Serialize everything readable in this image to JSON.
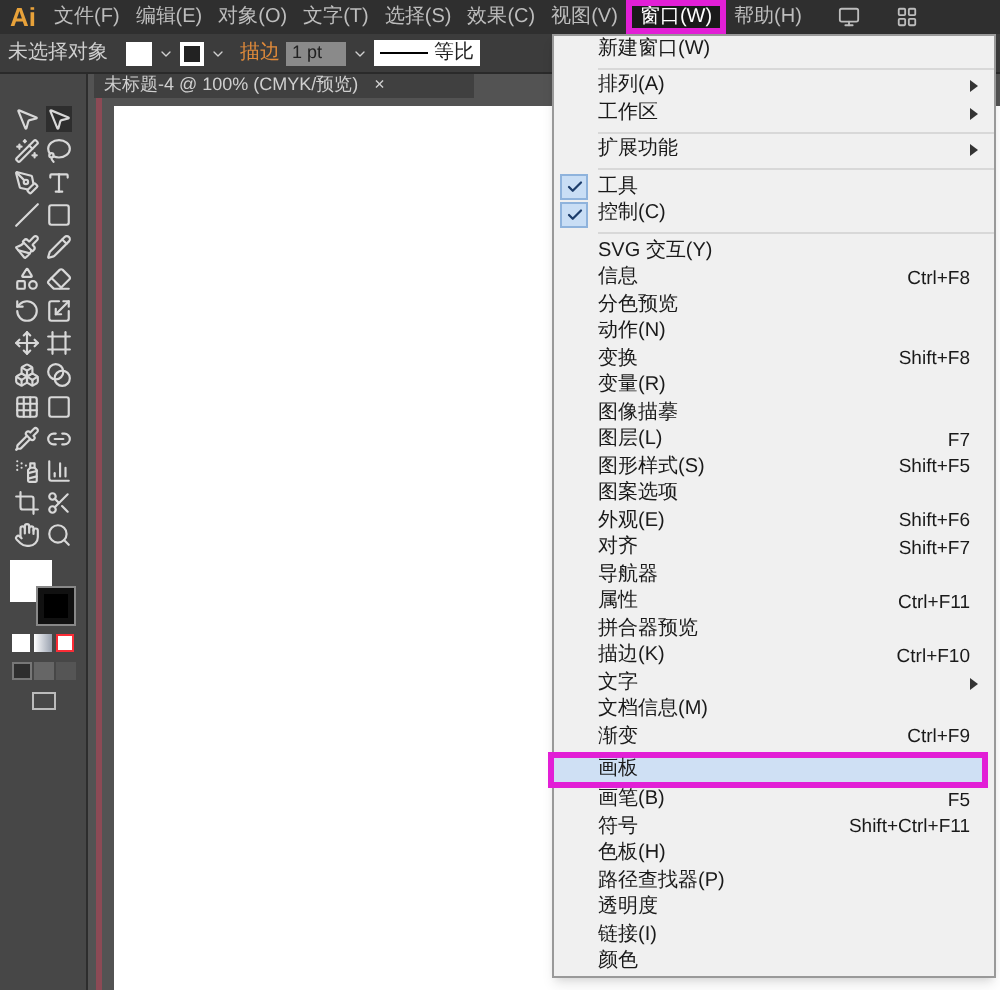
{
  "menubar": {
    "logo": "Ai",
    "items": [
      {
        "label": "文件(F)",
        "selected": false
      },
      {
        "label": "编辑(E)",
        "selected": false
      },
      {
        "label": "对象(O)",
        "selected": false
      },
      {
        "label": "文字(T)",
        "selected": false
      },
      {
        "label": "选择(S)",
        "selected": false
      },
      {
        "label": "效果(C)",
        "selected": false
      },
      {
        "label": "视图(V)",
        "selected": false
      },
      {
        "label": "窗口(W)",
        "selected": true
      },
      {
        "label": "帮助(H)",
        "selected": false
      }
    ]
  },
  "control_bar": {
    "selection": "未选择对象",
    "stroke_label": "描边",
    "stroke_weight": "1 pt",
    "stroke_profile": "等比"
  },
  "document_tab": {
    "title": "未标题-4 @ 100% (CMYK/预览)",
    "close": "×"
  },
  "window_menu": [
    {
      "kind": "item",
      "label": "新建窗口(W)",
      "checked": false,
      "submenu": false,
      "selected": false
    },
    {
      "kind": "separator"
    },
    {
      "kind": "item",
      "label": "排列(A)",
      "checked": false,
      "submenu": true,
      "selected": false
    },
    {
      "kind": "item",
      "label": "工作区",
      "checked": false,
      "submenu": true,
      "selected": false
    },
    {
      "kind": "separator"
    },
    {
      "kind": "item",
      "label": "扩展功能",
      "checked": false,
      "submenu": true,
      "selected": false
    },
    {
      "kind": "separator"
    },
    {
      "kind": "item",
      "label": "工具",
      "checked": true,
      "submenu": false,
      "selected": false
    },
    {
      "kind": "item",
      "label": "控制(C)",
      "checked": true,
      "submenu": false,
      "selected": false
    },
    {
      "kind": "separator"
    },
    {
      "kind": "item",
      "label": "SVG 交互(Y)",
      "checked": false,
      "submenu": false,
      "selected": false
    },
    {
      "kind": "item",
      "label": "信息",
      "shortcut": "Ctrl+F8",
      "checked": false,
      "submenu": false,
      "selected": false
    },
    {
      "kind": "item",
      "label": "分色预览",
      "checked": false,
      "submenu": false,
      "selected": false
    },
    {
      "kind": "item",
      "label": "动作(N)",
      "checked": false,
      "submenu": false,
      "selected": false
    },
    {
      "kind": "item",
      "label": "变换",
      "shortcut": "Shift+F8",
      "checked": false,
      "submenu": false,
      "selected": false
    },
    {
      "kind": "item",
      "label": "变量(R)",
      "checked": false,
      "submenu": false,
      "selected": false
    },
    {
      "kind": "item",
      "label": "图像描摹",
      "checked": false,
      "submenu": false,
      "selected": false
    },
    {
      "kind": "item",
      "label": "图层(L)",
      "shortcut": "F7",
      "checked": false,
      "submenu": false,
      "selected": false
    },
    {
      "kind": "item",
      "label": "图形样式(S)",
      "shortcut": "Shift+F5",
      "checked": false,
      "submenu": false,
      "selected": false
    },
    {
      "kind": "item",
      "label": "图案选项",
      "checked": false,
      "submenu": false,
      "selected": false
    },
    {
      "kind": "item",
      "label": "外观(E)",
      "shortcut": "Shift+F6",
      "checked": false,
      "submenu": false,
      "selected": false
    },
    {
      "kind": "item",
      "label": "对齐",
      "shortcut": "Shift+F7",
      "checked": false,
      "submenu": false,
      "selected": false
    },
    {
      "kind": "item",
      "label": "导航器",
      "checked": false,
      "submenu": false,
      "selected": false
    },
    {
      "kind": "item",
      "label": "属性",
      "shortcut": "Ctrl+F11",
      "checked": false,
      "submenu": false,
      "selected": false
    },
    {
      "kind": "item",
      "label": "拼合器预览",
      "checked": false,
      "submenu": false,
      "selected": false
    },
    {
      "kind": "item",
      "label": "描边(K)",
      "shortcut": "Ctrl+F10",
      "checked": false,
      "submenu": false,
      "selected": false
    },
    {
      "kind": "item",
      "label": "文字",
      "checked": false,
      "submenu": true,
      "selected": false
    },
    {
      "kind": "item",
      "label": "文档信息(M)",
      "checked": false,
      "submenu": false,
      "selected": false
    },
    {
      "kind": "item",
      "label": "渐变",
      "shortcut": "Ctrl+F9",
      "checked": false,
      "submenu": false,
      "selected": false
    },
    {
      "kind": "item",
      "label": "画板",
      "checked": false,
      "submenu": false,
      "selected": true
    },
    {
      "kind": "item",
      "label": "画笔(B)",
      "shortcut": "F5",
      "checked": false,
      "submenu": false,
      "selected": false
    },
    {
      "kind": "item",
      "label": "符号",
      "shortcut": "Shift+Ctrl+F11",
      "checked": false,
      "submenu": false,
      "selected": false
    },
    {
      "kind": "item",
      "label": "色板(H)",
      "checked": false,
      "submenu": false,
      "selected": false
    },
    {
      "kind": "item",
      "label": "路径查找器(P)",
      "checked": false,
      "submenu": false,
      "selected": false
    },
    {
      "kind": "item",
      "label": "透明度",
      "checked": false,
      "submenu": false,
      "selected": false
    },
    {
      "kind": "item",
      "label": "链接(I)",
      "checked": false,
      "submenu": false,
      "selected": false
    },
    {
      "kind": "item",
      "label": "颜色",
      "checked": false,
      "submenu": false,
      "selected": false
    }
  ]
}
